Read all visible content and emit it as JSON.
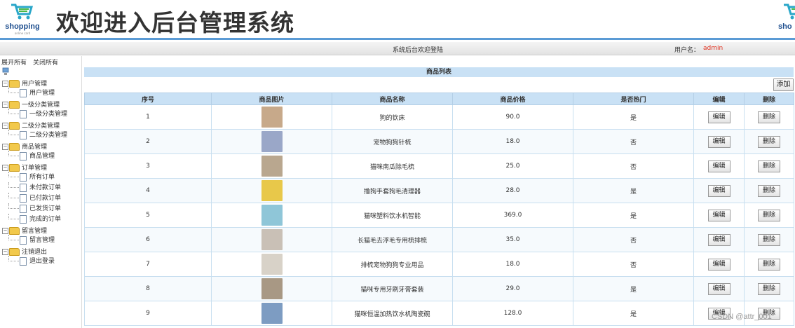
{
  "header": {
    "title": "欢迎进入后台管理系统",
    "logo_text": "shopping",
    "logo_sub": "online card",
    "logo_right_text": "sho"
  },
  "status": {
    "welcome": "系统后台欢迎登陆",
    "user_label": "用户名：",
    "user_name": "admin"
  },
  "sidebar": {
    "expand_all": "展开所有",
    "collapse_all": "关闭所有",
    "tree": [
      {
        "label": "用户管理",
        "children": [
          "用户管理"
        ]
      },
      {
        "label": "一级分类管理",
        "children": [
          "一级分类管理"
        ]
      },
      {
        "label": "二级分类管理",
        "children": [
          "二级分类管理"
        ]
      },
      {
        "label": "商品管理",
        "children": [
          "商品管理"
        ]
      },
      {
        "label": "订单管理",
        "children": [
          "所有订单",
          "未付款订单",
          "已付款订单",
          "已发货订单",
          "完成的订单"
        ]
      },
      {
        "label": "留言管理",
        "children": [
          "留言管理"
        ]
      },
      {
        "label": "注销退出",
        "children": [
          "退出登录"
        ]
      }
    ]
  },
  "main": {
    "list_title": "商品列表",
    "add_label": "添加",
    "columns": [
      "序号",
      "商品图片",
      "商品名称",
      "商品价格",
      "是否热门",
      "编辑",
      "删除"
    ],
    "edit_label": "编辑",
    "delete_label": "删除",
    "rows": [
      {
        "no": "1",
        "name": "狗的钦床",
        "price": "90.0",
        "hot": "是",
        "thumb_color": "#c7a98a"
      },
      {
        "no": "2",
        "name": "宠物狗狗针梳",
        "price": "18.0",
        "hot": "否",
        "thumb_color": "#9aa7c8"
      },
      {
        "no": "3",
        "name": "猫咪南瓜除毛梳",
        "price": "25.0",
        "hot": "否",
        "thumb_color": "#b9a78f"
      },
      {
        "no": "4",
        "name": "撸狗手套狗毛清理器",
        "price": "28.0",
        "hot": "是",
        "thumb_color": "#e8c84a"
      },
      {
        "no": "5",
        "name": "猫咪塑料饮水机智能",
        "price": "369.0",
        "hot": "是",
        "thumb_color": "#8fc6d8"
      },
      {
        "no": "6",
        "name": "长猫毛去浮毛专用梳排梳",
        "price": "35.0",
        "hot": "否",
        "thumb_color": "#c9c0b6"
      },
      {
        "no": "7",
        "name": "排梳宠物狗狗专业用品",
        "price": "18.0",
        "hot": "否",
        "thumb_color": "#d8d2c8"
      },
      {
        "no": "8",
        "name": "猫咪专用牙刷牙膏套装",
        "price": "29.0",
        "hot": "是",
        "thumb_color": "#a89884"
      },
      {
        "no": "9",
        "name": "猫咪恒温加热饮水机陶瓷碗",
        "price": "128.0",
        "hot": "是",
        "thumb_color": "#7d9cc2"
      }
    ]
  },
  "watermark": "CSDN @attr_001",
  "colors": {
    "accent": "#5b9bd5",
    "header_bg": "#c9e1f5",
    "user": "#e0301e"
  }
}
